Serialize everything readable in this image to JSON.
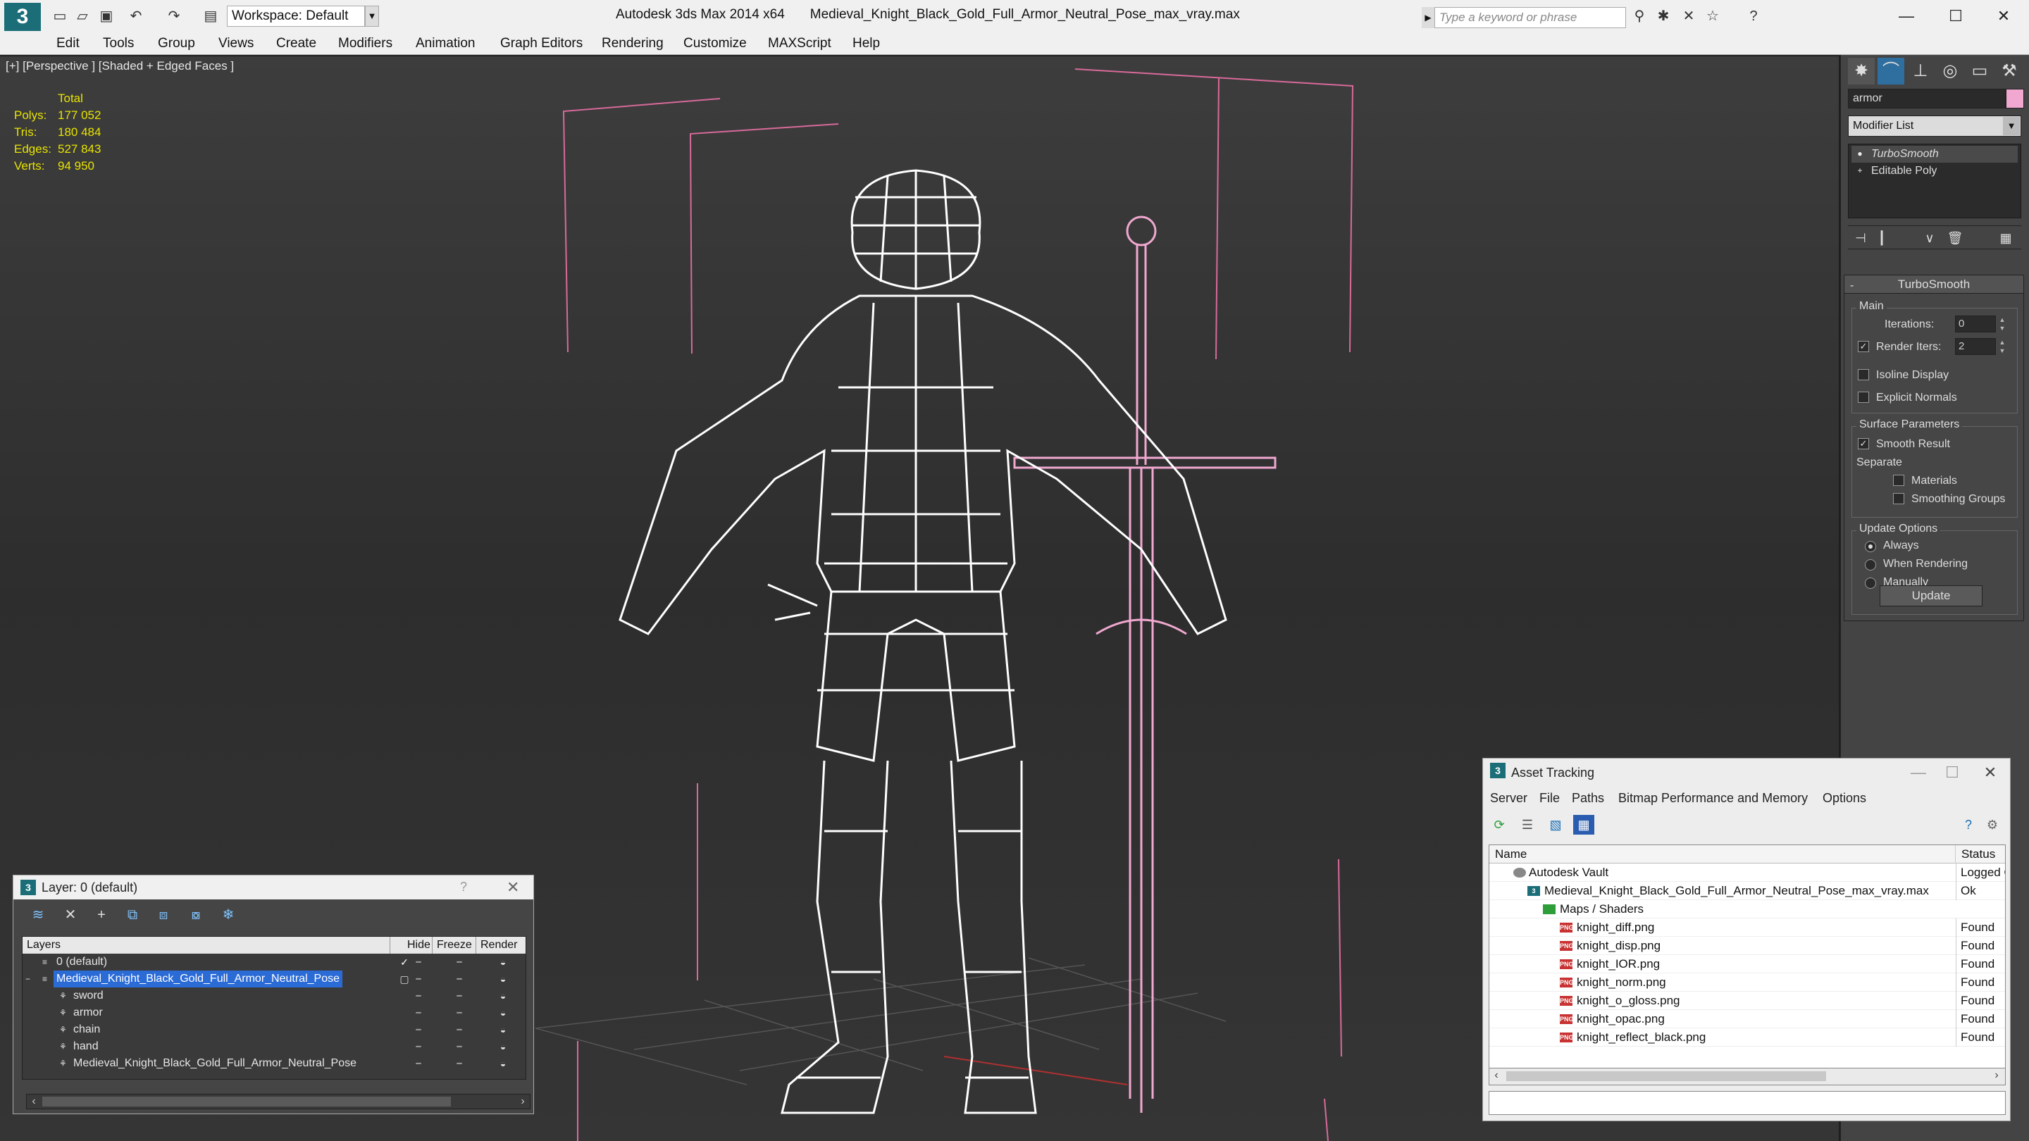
{
  "titlebar": {
    "app": "Autodesk 3ds Max  2014 x64",
    "file": "Medieval_Knight_Black_Gold_Full_Armor_Neutral_Pose_max_vray.max",
    "workspace": "Workspace: Default",
    "search_placeholder": "Type a keyword or phrase"
  },
  "menu": [
    "Edit",
    "Tools",
    "Group",
    "Views",
    "Create",
    "Modifiers",
    "Animation",
    "Graph Editors",
    "Rendering",
    "Customize",
    "MAXScript",
    "Help"
  ],
  "viewport": {
    "label": "[+] [Perspective ] [Shaded + Edged Faces ]",
    "stats": {
      "total_label": "Total",
      "rows": [
        {
          "label": "Polys:",
          "value": "177 052"
        },
        {
          "label": "Tris:",
          "value": "180 484"
        },
        {
          "label": "Edges:",
          "value": "527 843"
        },
        {
          "label": "Verts:",
          "value": "94 950"
        }
      ]
    }
  },
  "command_panel": {
    "object_name": "armor",
    "object_color": "#f0a8d0",
    "modifier_list": "Modifier List",
    "stack": [
      "TurboSmooth",
      "Editable Poly"
    ],
    "rollout": {
      "title": "TurboSmooth",
      "main": "Main",
      "iterations_label": "Iterations:",
      "iterations_value": "0",
      "render_iters_label": "Render Iters:",
      "render_iters_value": "2",
      "render_iters_checked": true,
      "isoline": "Isoline Display",
      "explicit_normals": "Explicit Normals",
      "surface_params": "Surface Parameters",
      "smooth_result": "Smooth Result",
      "separate": "Separate",
      "materials": "Materials",
      "smoothing_groups": "Smoothing Groups",
      "update_options": "Update Options",
      "always": "Always",
      "when_rendering": "When Rendering",
      "manually": "Manually",
      "update_button": "Update"
    }
  },
  "layer_dialog": {
    "title": "Layer: 0 (default)",
    "help": "?",
    "columns": [
      "Layers",
      "Hide",
      "Freeze",
      "Render"
    ],
    "rows": [
      {
        "name": "0 (default)",
        "indent": 0
      },
      {
        "name": "Medieval_Knight_Black_Gold_Full_Armor_Neutral_Pose",
        "indent": 0
      },
      {
        "name": "sword",
        "indent": 1
      },
      {
        "name": "armor",
        "indent": 1
      },
      {
        "name": "chain",
        "indent": 1
      },
      {
        "name": "hand",
        "indent": 1
      },
      {
        "name": "Medieval_Knight_Black_Gold_Full_Armor_Neutral_Pose",
        "indent": 1
      }
    ]
  },
  "asset_tracking": {
    "title": "Asset Tracking",
    "menu": [
      "Server",
      "File",
      "Paths",
      "Bitmap Performance and Memory",
      "Options"
    ],
    "columns": [
      "Name",
      "Status"
    ],
    "rows": [
      {
        "name": "Autodesk Vault",
        "status": "Logged Out"
      },
      {
        "name": "Medieval_Knight_Black_Gold_Full_Armor_Neutral_Pose_max_vray.max",
        "status": "Ok"
      },
      {
        "name": "Maps / Shaders",
        "status": ""
      },
      {
        "name": "knight_diff.png",
        "status": "Found"
      },
      {
        "name": "knight_disp.png",
        "status": "Found"
      },
      {
        "name": "knight_IOR.png",
        "status": "Found"
      },
      {
        "name": "knight_norm.png",
        "status": "Found"
      },
      {
        "name": "knight_o_gloss.png",
        "status": "Found"
      },
      {
        "name": "knight_opac.png",
        "status": "Found"
      },
      {
        "name": "knight_reflect_black.png",
        "status": "Found"
      }
    ],
    "icons": {
      "png": "PNG",
      "max": "3"
    }
  }
}
